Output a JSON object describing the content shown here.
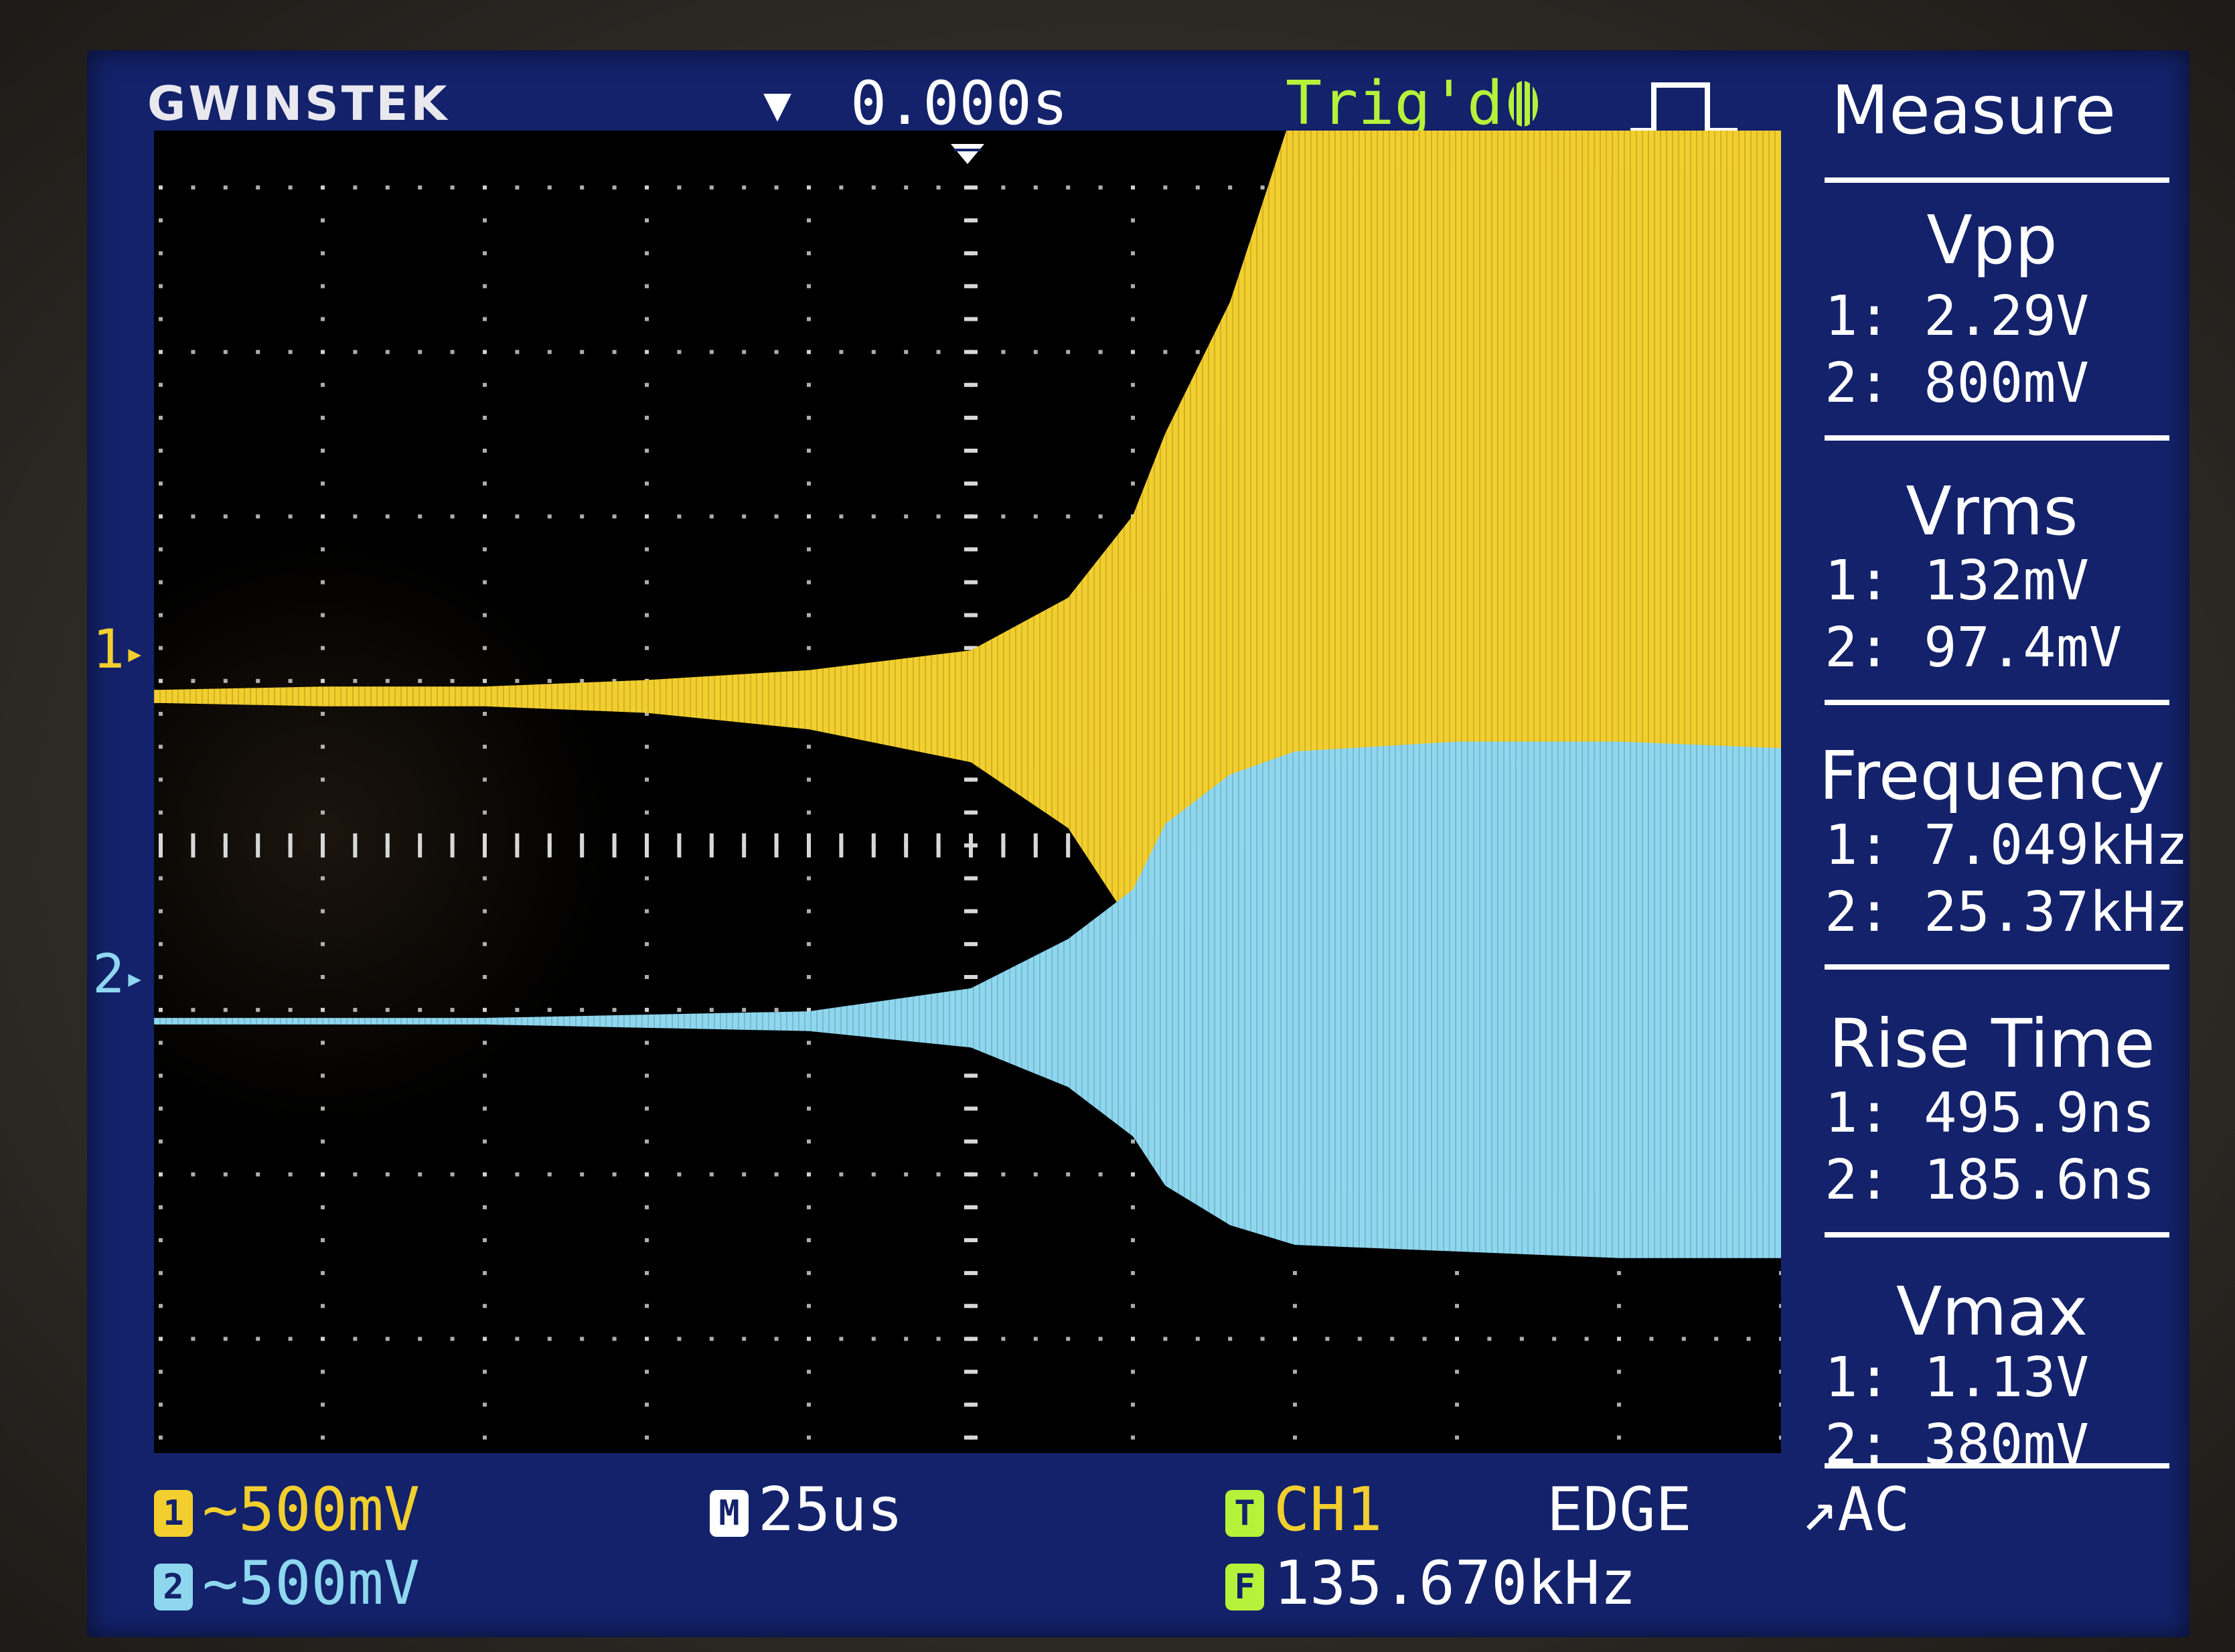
{
  "brand": "GWINSTEK",
  "header": {
    "time_offset": "0.000s",
    "trigger_status": "Trig'd"
  },
  "channels": {
    "ch1_marker": "1",
    "ch2_marker": "2",
    "ch1_color": "#f2cf2e",
    "ch2_color": "#8ed7ef"
  },
  "measure": {
    "title": "Measure",
    "items": [
      {
        "name": "Vpp",
        "ch1": "1: 2.29V",
        "ch2": "2: 800mV"
      },
      {
        "name": "Vrms",
        "ch1": "1: 132mV",
        "ch2": "2: 97.4mV"
      },
      {
        "name": "Frequency",
        "ch1": "1: 7.049kHz",
        "ch2": "2: 25.37kHz"
      },
      {
        "name": "Rise Time",
        "ch1": "1: 495.9ns",
        "ch2": "2: 185.6ns"
      },
      {
        "name": "Vmax",
        "ch1": "1: 1.13V",
        "ch2": "2: 380mV"
      }
    ]
  },
  "status": {
    "ch1_scale": "~500mV",
    "ch2_scale": "~500mV",
    "timebase": "25us",
    "trigger_source": "CH1",
    "trigger_type": "EDGE",
    "trigger_coupling": "AC",
    "trigger_frequency": "135.670kHz"
  },
  "colors": {
    "screen_bg": "#13226b",
    "grid_bg": "#000000",
    "trigger_green": "#b6f23a",
    "grid_dots": "#d8d8d8"
  },
  "chart_data": {
    "type": "area",
    "x": [
      -150,
      -125,
      -100,
      -75,
      -50,
      -25,
      0,
      15,
      25,
      30,
      40,
      50,
      75,
      100,
      125,
      150,
      175,
      200,
      225,
      250,
      275,
      300,
      325,
      350,
      375,
      400,
      425,
      450,
      475,
      500,
      525,
      550,
      575,
      600,
      625,
      650,
      675,
      700,
      725,
      750,
      775,
      800,
      825,
      850
    ],
    "series": [
      {
        "upper": [
          0.02,
          0.02,
          0.03,
          0.03,
          0.05,
          0.08,
          0.14,
          0.3,
          0.55,
          0.8,
          1.2,
          1.8,
          2.1,
          2.15,
          2.1,
          2.2,
          2.15,
          2.2,
          2.3,
          2.2,
          2.25,
          2.3,
          2.3,
          2.35,
          2.3,
          2.4,
          2.35,
          2.3,
          2.3,
          2.2,
          2.2,
          2.25,
          2.15,
          2.1,
          2.05,
          1.95,
          1.9,
          1.9,
          1.85,
          1.9,
          1.95,
          1.9,
          1.85,
          1.8
        ],
        "lower": [
          -0.02,
          -0.02,
          -0.03,
          -0.03,
          -0.05,
          -0.1,
          -0.2,
          -0.4,
          -0.7,
          -0.95,
          -1.15,
          -1.2,
          -1.2,
          -1.2,
          -1.18,
          -1.18,
          -1.16,
          -1.15,
          -1.15,
          -1.14,
          -1.12,
          -1.13,
          -1.15,
          -1.15,
          -1.14,
          -1.15,
          -1.13,
          -1.14,
          -1.14,
          -1.12,
          -1.15,
          -1.18,
          -1.2,
          -1.25,
          -1.28,
          -1.3,
          -1.3,
          -1.3,
          -1.3,
          -1.3,
          -1.3,
          -1.3,
          -1.3,
          -1.3
        ]
      },
      {
        "upper": [
          0.01,
          0.01,
          0.01,
          0.01,
          0.02,
          0.03,
          0.1,
          0.25,
          0.4,
          0.6,
          0.75,
          0.82,
          0.85,
          0.85,
          0.83,
          0.84,
          0.85,
          0.86,
          0.87,
          0.86,
          0.87,
          0.87,
          0.86,
          0.86,
          0.85,
          0.84,
          0.84,
          0.84,
          0.83,
          0.82,
          0.8,
          0.79,
          0.78,
          0.77,
          0.76,
          0.75,
          0.75,
          0.75,
          0.74,
          0.74,
          0.74,
          0.73,
          0.73,
          0.73
        ],
        "lower": [
          -0.01,
          -0.01,
          -0.01,
          -0.01,
          -0.02,
          -0.03,
          -0.08,
          -0.2,
          -0.35,
          -0.5,
          -0.62,
          -0.68,
          -0.7,
          -0.72,
          -0.72,
          -0.73,
          -0.73,
          -0.73,
          -0.73,
          -0.72,
          -0.73,
          -0.73,
          -0.72,
          -0.72,
          -0.71,
          -0.7,
          -0.7,
          -0.69,
          -0.68,
          -0.67,
          -0.66,
          -0.65,
          -0.64,
          -0.63,
          -0.62,
          -0.62,
          -0.61,
          -0.6,
          -0.6,
          -0.6,
          -0.6,
          -0.59,
          -0.59,
          -0.59
        ]
      }
    ]
  }
}
